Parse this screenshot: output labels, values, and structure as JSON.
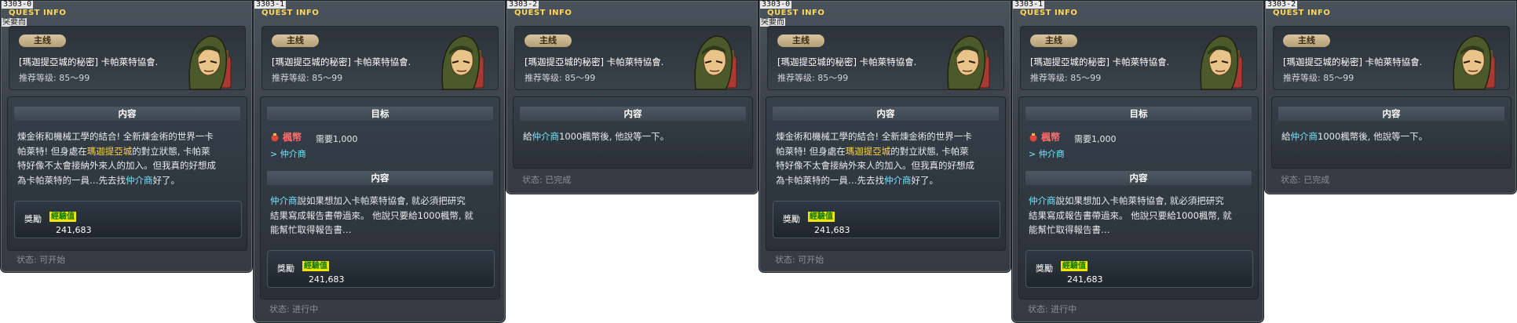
{
  "panels": [
    {
      "id": "3303-0",
      "header_label": "QUEST INFO",
      "sub_label": "突要而",
      "category": "主线",
      "title": "[瑪迦提亞城的秘密] 卡帕萊特協會.",
      "level": "推荐等级:  85～99",
      "content_heading": "内容",
      "content_lines": [
        "煉金術和機械工學的結合! 全新煉金術的世界一卡",
        "帕萊特! 但身處在|瑪迦提亞城|的對立狀態, 卡帕萊",
        "特好像不太會接納外來人的加入。但我真的好想成",
        "為卡帕萊特的一員…先去找|仲介商|好了。"
      ],
      "reward_label": "獎勵",
      "reward_exp": "經驗值",
      "reward_amount": "241,683",
      "status": "状态:  可开始"
    },
    {
      "id": "3303-1",
      "header_label": "QUEST INFO",
      "sub_label": "",
      "category": "主线",
      "title": "[瑪迦提亞城的秘密] 卡帕萊特協會.",
      "level": "推荐等级:  85～99",
      "goal_heading": "目标",
      "goal_meso": "楓幣",
      "goal_need": "需要1,000",
      "goal_npc": "> 仲介商",
      "content_heading": "内容",
      "content_lines": [
        "|仲介商|說如果想加入卡帕萊特協會, 就必須把研究",
        "結果寫成報告書帶過來。 他說只要給1000楓幣, 就",
        "能幫忙取得報告書…"
      ],
      "reward_label": "獎勵",
      "reward_exp": "經驗值",
      "reward_amount": "241,683",
      "status": "状态:  进行中"
    },
    {
      "id": "3303-2",
      "header_label": "QUEST INFO",
      "sub_label": "",
      "category": "主线",
      "title": "[瑪迦提亞城的秘密] 卡帕萊特協會.",
      "level": "推荐等级:  85～99",
      "content_heading": "内容",
      "content_lines": [
        "給|仲介商|1000楓幣後, 他說等一下。"
      ],
      "status": "状态:  已完成"
    },
    {
      "id": "3303-0",
      "header_label": "QUEST INFO",
      "sub_label": "突要而",
      "category": "主线",
      "title": "[瑪迦提亞城的秘密] 卡帕萊特協會.",
      "level": "推荐等级:  85～99",
      "content_heading": "内容",
      "content_lines": [
        "煉金術和機械工學的結合! 全新煉金術的世界一卡",
        "帕萊特! 但身處在|瑪迦提亞城|的對立狀態, 卡帕萊",
        "特好像不太會接納外來人的加入。但我真的好想成",
        "為卡帕萊特的一員…先去找|仲介商|好了。"
      ],
      "reward_label": "獎勵",
      "reward_exp": "經驗值",
      "reward_amount": "241,683",
      "status": "状态:  可开始"
    },
    {
      "id": "3303-1",
      "header_label": "QUEST INFO",
      "sub_label": "",
      "category": "主线",
      "title": "[瑪迦提亞城的秘密] 卡帕萊特協會.",
      "level": "推荐等级:  85～99",
      "goal_heading": "目标",
      "goal_meso": "楓幣",
      "goal_need": "需要1,000",
      "goal_npc": "> 仲介商",
      "content_heading": "内容",
      "content_lines": [
        "|仲介商|說如果想加入卡帕萊特協會, 就必須把研究",
        "結果寫成報告書帶過來。 他說只要給1000楓幣, 就",
        "能幫忙取得報告書…"
      ],
      "reward_label": "獎勵",
      "reward_exp": "經驗值",
      "reward_amount": "241,683",
      "status": "状态:  进行中"
    },
    {
      "id": "3303-2",
      "header_label": "QUEST INFO",
      "sub_label": "",
      "category": "主线",
      "title": "[瑪迦提亞城的秘密] 卡帕萊特協會.",
      "level": "推荐等级:  85～99",
      "content_heading": "内容",
      "content_lines": [
        "給|仲介商|1000楓幣後, 他說等一下。"
      ],
      "status": "状态:  已完成"
    }
  ],
  "colors": {
    "highlight_place": "#ffd34d",
    "highlight_npc": "#77e6ff",
    "meso": "#ff6a6a"
  }
}
